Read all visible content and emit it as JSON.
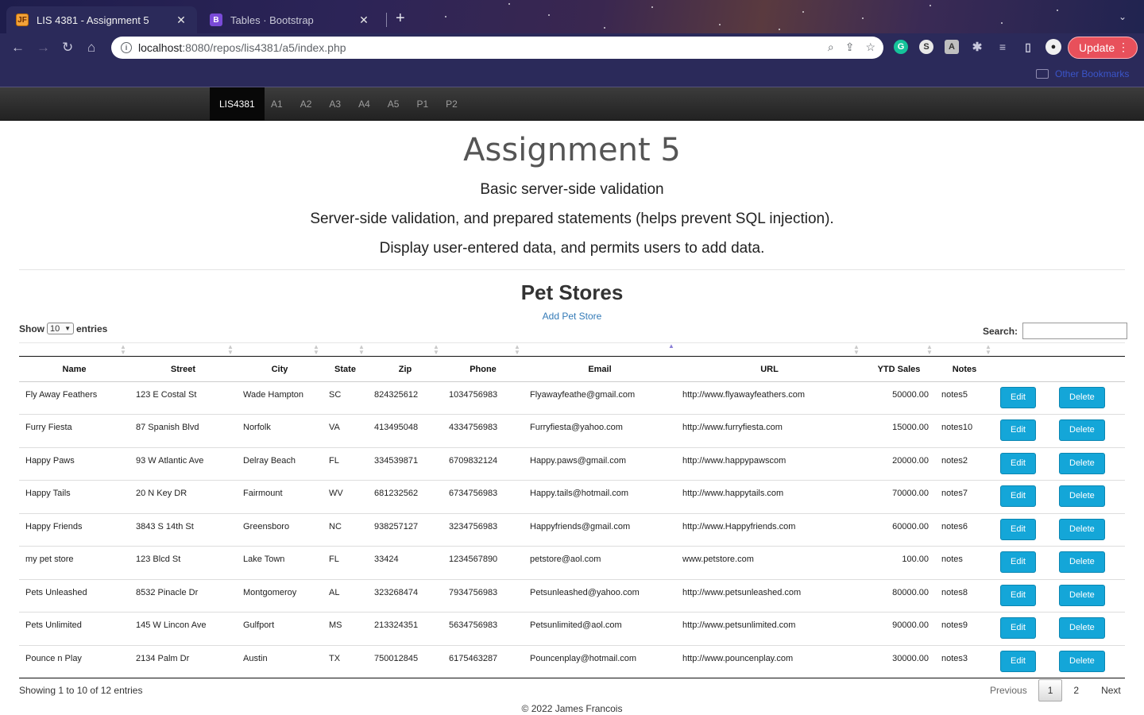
{
  "browser": {
    "tabs": [
      {
        "title": "LIS 4381 - Assignment 5",
        "favicon": "JF"
      },
      {
        "title": "Tables · Bootstrap",
        "favicon": "B"
      }
    ],
    "url_host": "localhost",
    "url_rest": ":8080/repos/lis4381/a5/index.php",
    "update_label": "Update",
    "bookmark_folder": "Other Bookmarks"
  },
  "nav": {
    "brand": "LIS4381",
    "links": [
      "A1",
      "A2",
      "A3",
      "A4",
      "A5",
      "P1",
      "P2"
    ]
  },
  "page": {
    "title": "Assignment 5",
    "lines": [
      "Basic server-side validation",
      "Server-side validation, and prepared statements (helps prevent SQL injection).",
      "Display user-entered data, and permits users to add data."
    ],
    "section_title": "Pet Stores",
    "add_link": "Add Pet Store"
  },
  "table_controls": {
    "show_label": "Show",
    "length_value": "10",
    "entries_label": "entries",
    "search_label": "Search:",
    "search_value": ""
  },
  "table": {
    "columns": [
      "Name",
      "Street",
      "City",
      "State",
      "Zip",
      "Phone",
      "Email",
      "URL",
      "YTD Sales",
      "Notes"
    ],
    "edit_label": "Edit",
    "delete_label": "Delete",
    "rows": [
      [
        "Fly Away Feathers",
        "123 E Costal St",
        "Wade Hampton",
        "SC",
        "824325612",
        "1034756983",
        "Flyawayfeathe@gmail.com",
        "http://www.flyawayfeathers.com",
        "50000.00",
        "notes5"
      ],
      [
        "Furry Fiesta",
        "87 Spanish Blvd",
        "Norfolk",
        "VA",
        "413495048",
        "4334756983",
        "Furryfiesta@yahoo.com",
        "http://www.furryfiesta.com",
        "15000.00",
        "notes10"
      ],
      [
        "Happy Paws",
        "93 W Atlantic Ave",
        "Delray Beach",
        "FL",
        "334539871",
        "6709832124",
        "Happy.paws@gmail.com",
        "http://www.happypawscom",
        "20000.00",
        "notes2"
      ],
      [
        "Happy Tails",
        "20 N Key DR",
        "Fairmount",
        "WV",
        "681232562",
        "6734756983",
        "Happy.tails@hotmail.com",
        "http://www.happytails.com",
        "70000.00",
        "notes7"
      ],
      [
        "Happy Friends",
        "3843 S 14th St",
        "Greensboro",
        "NC",
        "938257127",
        "3234756983",
        "Happyfriends@gmail.com",
        "http://www.Happyfriends.com",
        "60000.00",
        "notes6"
      ],
      [
        "my pet store",
        "123 Blcd St",
        "Lake Town",
        "FL",
        "33424",
        "1234567890",
        "petstore@aol.com",
        "www.petstore.com",
        "100.00",
        "notes"
      ],
      [
        "Pets Unleashed",
        "8532 Pinacle Dr",
        "Montgomeroy",
        "AL",
        "323268474",
        "7934756983",
        "Petsunleashed@yahoo.com",
        "http://www.petsunleashed.com",
        "80000.00",
        "notes8"
      ],
      [
        "Pets Unlimited",
        "145 W Lincon Ave",
        "Gulfport",
        "MS",
        "213324351",
        "5634756983",
        "Petsunlimited@aol.com",
        "http://www.petsunlimited.com",
        "90000.00",
        "notes9"
      ],
      [
        "Pounce n Play",
        "2134 Palm Dr",
        "Austin",
        "TX",
        "750012845",
        "6175463287",
        "Pouncenplay@hotmail.com",
        "http://www.pouncenplay.com",
        "30000.00",
        "notes3"
      ]
    ]
  },
  "pagination": {
    "info": "Showing 1 to 10 of 12 entries",
    "previous": "Previous",
    "pages": [
      "1",
      "2"
    ],
    "next": "Next"
  },
  "footer": "© 2022 James Francois",
  "colors": {
    "button": "#14a6d8",
    "link": "#337ab7",
    "navbar": "#222222",
    "update": "#e8505b"
  }
}
